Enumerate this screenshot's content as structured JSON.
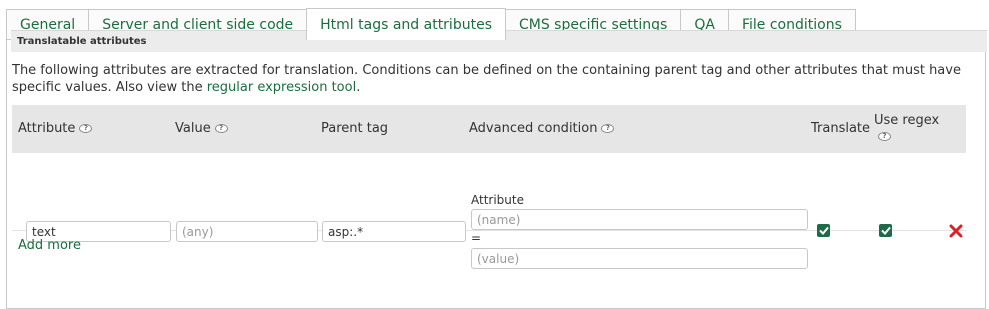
{
  "tabs": [
    {
      "label": "General"
    },
    {
      "label": "Server and client side code"
    },
    {
      "label": "Html tags and attributes",
      "active": true
    },
    {
      "label": "CMS specific settings"
    },
    {
      "label": "QA"
    },
    {
      "label": "File conditions"
    }
  ],
  "section": {
    "title": "Translatable attributes",
    "description": "The following attributes are extracted for translation. Conditions can be defined on the containing parent tag and other attributes that must have specific values. Also view the",
    "link_text": "regular expression tool",
    "description_end": "."
  },
  "table": {
    "headers": {
      "attribute": "Attribute",
      "value": "Value",
      "parent_tag": "Parent tag",
      "advanced_condition": "Advanced condition",
      "translate": "Translate",
      "use_regex": "Use regex"
    },
    "help_glyph": "?",
    "rows": [
      {
        "attribute": "text",
        "value_placeholder": "(any)",
        "parent_tag": "asp:.*",
        "cond_label": "Attribute",
        "cond_name_placeholder": "(name)",
        "cond_eq": "=",
        "cond_value_placeholder": "(value)",
        "translate": true,
        "use_regex": true
      }
    ]
  },
  "add_more": "Add more",
  "colors": {
    "accent_green": "#1b6e3c",
    "checkbox_green": "#1f6b49",
    "delete_red": "#d9212a",
    "header_gray": "#e6e6e6"
  },
  "icons": {
    "help": "help-icon",
    "checkbox": "checkbox-checked-icon",
    "delete": "delete-x-icon"
  }
}
